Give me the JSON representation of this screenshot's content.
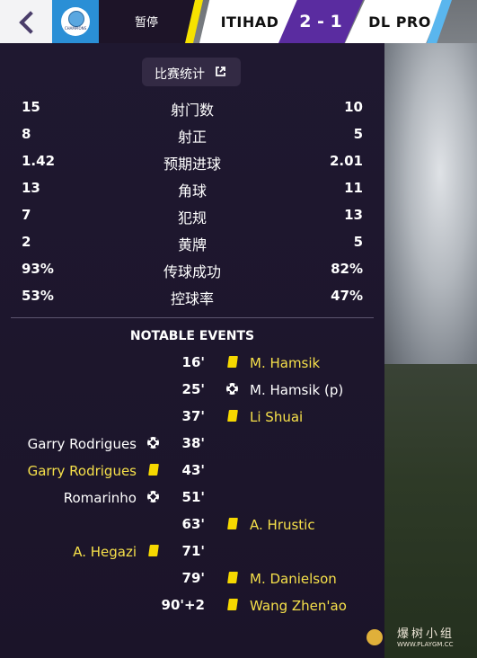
{
  "header": {
    "status_label": "暂停",
    "home_team": "ITIHAD",
    "score": "2 - 1",
    "away_team": "DL PRO",
    "competition_logo_text": "CHAMPIONS",
    "colors": {
      "home_accent": "#f6e200",
      "score_bg": "#5a2ca0",
      "away_accent": "#5ab6ee"
    }
  },
  "stats_toggle": {
    "label": "比赛统计",
    "icon": "popout-icon"
  },
  "stats": [
    {
      "home": "15",
      "label": "射门数",
      "away": "10"
    },
    {
      "home": "8",
      "label": "射正",
      "away": "5"
    },
    {
      "home": "1.42",
      "label": "预期进球",
      "away": "2.01"
    },
    {
      "home": "13",
      "label": "角球",
      "away": "11"
    },
    {
      "home": "7",
      "label": "犯规",
      "away": "13"
    },
    {
      "home": "2",
      "label": "黄牌",
      "away": "5"
    },
    {
      "home": "93%",
      "label": "传球成功",
      "away": "82%"
    },
    {
      "home": "53%",
      "label": "控球率",
      "away": "47%"
    }
  ],
  "events_title": "NOTABLE EVENTS",
  "events": [
    {
      "minute": "16'",
      "side": "away",
      "type": "yellow-card",
      "player": "M. Hamsik"
    },
    {
      "minute": "25'",
      "side": "away",
      "type": "goal",
      "player": "M. Hamsik (p)"
    },
    {
      "minute": "37'",
      "side": "away",
      "type": "yellow-card",
      "player": "Li Shuai"
    },
    {
      "minute": "38'",
      "side": "home",
      "type": "goal",
      "player": "Garry Rodrigues"
    },
    {
      "minute": "43'",
      "side": "home",
      "type": "yellow-card",
      "player": "Garry Rodrigues"
    },
    {
      "minute": "51'",
      "side": "home",
      "type": "goal",
      "player": "Romarinho"
    },
    {
      "minute": "63'",
      "side": "away",
      "type": "yellow-card",
      "player": "A. Hrustic"
    },
    {
      "minute": "71'",
      "side": "home",
      "type": "yellow-card",
      "player": "A. Hegazi"
    },
    {
      "minute": "79'",
      "side": "away",
      "type": "yellow-card",
      "player": "M. Danielson"
    },
    {
      "minute": "90'+2",
      "side": "away",
      "type": "yellow-card",
      "player": "Wang Zhen'ao"
    }
  ],
  "watermark": {
    "text": "爆树小组",
    "url": "WWW.PLAYGM.CC"
  }
}
